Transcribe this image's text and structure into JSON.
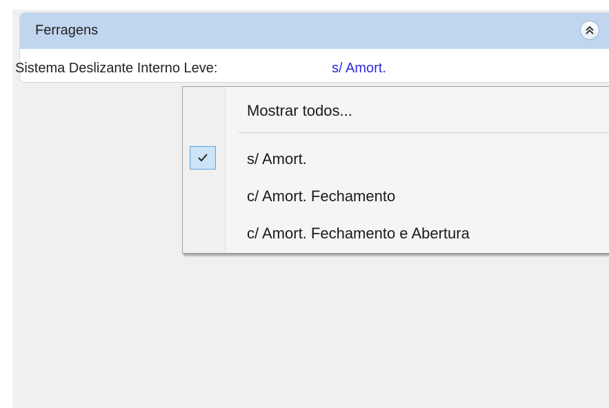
{
  "panel": {
    "title": "Ferragens",
    "property_label": "Sistema Deslizante Interno Leve:",
    "property_value": "s/ Amort."
  },
  "context_menu": {
    "show_all_label": "Mostrar todos...",
    "options": [
      {
        "label": "s/ Amort.",
        "checked": true
      },
      {
        "label": "c/ Amort. Fechamento",
        "checked": false
      },
      {
        "label": "c/ Amort. Fechamento e Abertura",
        "checked": false
      }
    ]
  },
  "icons": {
    "collapse": "double-chevron-up-icon",
    "check": "checkmark-icon"
  },
  "colors": {
    "header_bg": "#c0d6ef",
    "value_link": "#2b2bd9",
    "check_highlight": "#cce4f7"
  }
}
